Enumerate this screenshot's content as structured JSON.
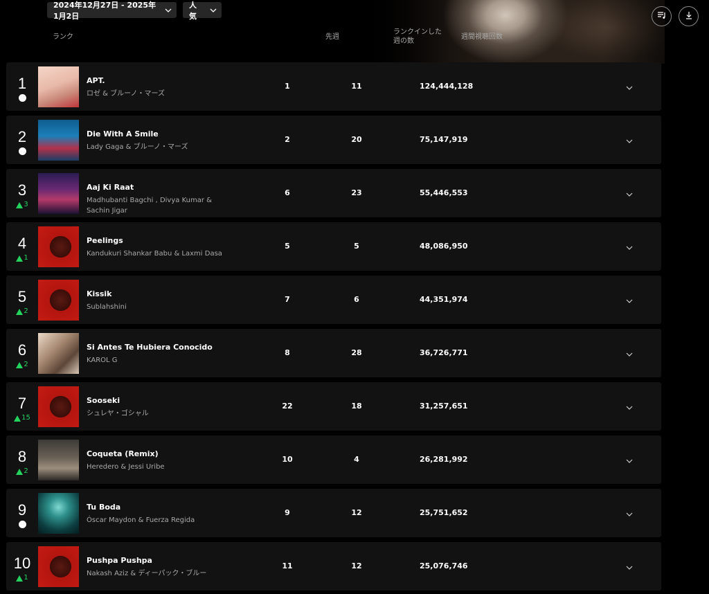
{
  "header": {
    "date_range": "2024年12月27日 - 2025年1月2日",
    "sort": "人気",
    "icons": {
      "playlist": "playlist-add-icon",
      "download": "download-icon"
    }
  },
  "columns": {
    "rank": "ランク",
    "last_week": "先週",
    "weeks_line1": "ランクインした",
    "weeks_line2": "週の数",
    "views": "週間視聴回数"
  },
  "colors": {
    "up": "#24d35e",
    "row_bg": "#121212",
    "secondary_text": "#aaaaaa"
  },
  "rows": [
    {
      "rank": "1",
      "change": "",
      "change_type": "same",
      "title": "APT.",
      "artist": "ロゼ & ブルーノ・マーズ",
      "last_week": "1",
      "weeks": "11",
      "views": "124,444,128",
      "art": "art-apt"
    },
    {
      "rank": "2",
      "change": "",
      "change_type": "same",
      "title": "Die With A Smile",
      "artist": "Lady Gaga & ブルーノ・マーズ",
      "last_week": "2",
      "weeks": "20",
      "views": "75,147,919",
      "art": "art-dwas"
    },
    {
      "rank": "3",
      "change": "3",
      "change_type": "up",
      "title": "Aaj Ki Raat",
      "artist": "Madhubanti Bagchi , Divya Kumar & Sachin Jigar",
      "last_week": "6",
      "weeks": "23",
      "views": "55,446,553",
      "art": "art-aaj"
    },
    {
      "rank": "4",
      "change": "1",
      "change_type": "up",
      "title": "Peelings",
      "artist": "Kandukuri Shankar Babu & Laxmi Dasa",
      "last_week": "5",
      "weeks": "5",
      "views": "48,086,950",
      "art": "art-red"
    },
    {
      "rank": "5",
      "change": "2",
      "change_type": "up",
      "title": "Kissik",
      "artist": "Sublahshini",
      "last_week": "7",
      "weeks": "6",
      "views": "44,351,974",
      "art": "art-red"
    },
    {
      "rank": "6",
      "change": "2",
      "change_type": "up",
      "title": "Si Antes Te Hubiera Conocido",
      "artist": "KAROL G",
      "last_week": "8",
      "weeks": "28",
      "views": "36,726,771",
      "art": "art-si"
    },
    {
      "rank": "7",
      "change": "15",
      "change_type": "up",
      "title": "Sooseki",
      "artist": "シュレヤ・ゴシャル",
      "last_week": "22",
      "weeks": "18",
      "views": "31,257,651",
      "art": "art-red"
    },
    {
      "rank": "8",
      "change": "2",
      "change_type": "up",
      "title": "Coqueta (Remix)",
      "artist": "Heredero & Jessi Uribe",
      "last_week": "10",
      "weeks": "4",
      "views": "26,281,992",
      "art": "art-coq"
    },
    {
      "rank": "9",
      "change": "",
      "change_type": "same",
      "title": "Tu Boda",
      "artist": "Óscar Maydon & Fuerza Regida",
      "last_week": "9",
      "weeks": "12",
      "views": "25,751,652",
      "art": "art-tu"
    },
    {
      "rank": "10",
      "change": "1",
      "change_type": "up",
      "title": "Pushpa Pushpa",
      "artist": "Nakash Aziz & ディーパック・ブルー",
      "last_week": "11",
      "weeks": "12",
      "views": "25,076,746",
      "art": "art-red"
    }
  ]
}
